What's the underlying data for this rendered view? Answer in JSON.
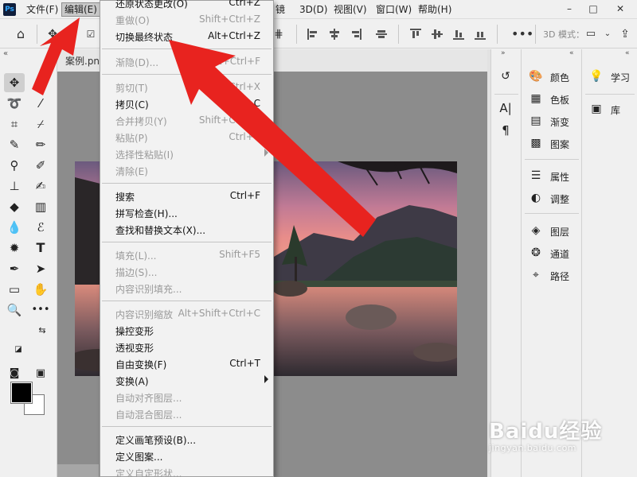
{
  "app": {
    "logo_text": "Ps"
  },
  "menubar": {
    "items": [
      "文件(F)",
      "编辑(E)",
      "镜",
      "3D(D)",
      "视图(V)",
      "窗口(W)",
      "帮助(H)"
    ],
    "active": "编辑(E)"
  },
  "window_controls": [
    "–",
    "□",
    "✕"
  ],
  "options_bar": {
    "three_d_label": "3D 模式："
  },
  "document": {
    "tab_name": "案例.png"
  },
  "edit_menu": {
    "items": [
      {
        "label": "还原状态更改(O)",
        "shortcut": "Ctrl+Z",
        "enabled": true
      },
      {
        "label": "重做(O)",
        "shortcut": "Shift+Ctrl+Z",
        "enabled": false
      },
      {
        "label": "切换最终状态",
        "shortcut": "Alt+Ctrl+Z",
        "enabled": true
      },
      {
        "separator": true
      },
      {
        "label": "渐隐(D)...",
        "shortcut": "Shift+Ctrl+F",
        "enabled": false
      },
      {
        "separator": true
      },
      {
        "label": "剪切(T)",
        "shortcut": "Ctrl+X",
        "enabled": false
      },
      {
        "label": "拷贝(C)",
        "shortcut": "Ctrl+C",
        "enabled": true
      },
      {
        "label": "合并拷贝(Y)",
        "shortcut": "Shift+Ctrl+C",
        "enabled": false
      },
      {
        "label": "粘贴(P)",
        "shortcut": "Ctrl+V",
        "enabled": false
      },
      {
        "label": "选择性粘贴(I)",
        "shortcut": "",
        "enabled": false,
        "submenu": true
      },
      {
        "label": "清除(E)",
        "shortcut": "",
        "enabled": false
      },
      {
        "separator": true
      },
      {
        "label": "搜索",
        "shortcut": "Ctrl+F",
        "enabled": true
      },
      {
        "label": "拼写检查(H)...",
        "shortcut": "",
        "enabled": true
      },
      {
        "label": "查找和替换文本(X)...",
        "shortcut": "",
        "enabled": true
      },
      {
        "separator": true
      },
      {
        "label": "填充(L)...",
        "shortcut": "Shift+F5",
        "enabled": false
      },
      {
        "label": "描边(S)...",
        "shortcut": "",
        "enabled": false
      },
      {
        "label": "内容识别填充...",
        "shortcut": "",
        "enabled": false
      },
      {
        "separator": true
      },
      {
        "label": "内容识别缩放",
        "shortcut": "Alt+Shift+Ctrl+C",
        "enabled": false
      },
      {
        "label": "操控变形",
        "shortcut": "",
        "enabled": true
      },
      {
        "label": "透视变形",
        "shortcut": "",
        "enabled": true
      },
      {
        "label": "自由变换(F)",
        "shortcut": "Ctrl+T",
        "enabled": true
      },
      {
        "label": "变换(A)",
        "shortcut": "",
        "enabled": true,
        "submenu": true
      },
      {
        "label": "自动对齐图层...",
        "shortcut": "",
        "enabled": false
      },
      {
        "label": "自动混合图层...",
        "shortcut": "",
        "enabled": false
      },
      {
        "separator": true
      },
      {
        "label": "定义画笔预设(B)...",
        "shortcut": "",
        "enabled": true
      },
      {
        "label": "定义图案...",
        "shortcut": "",
        "enabled": true
      },
      {
        "label": "定义自定形状...",
        "shortcut": "",
        "enabled": false
      }
    ]
  },
  "right_panels": {
    "column1": [
      {
        "icon": "history-icon",
        "glyph": "↺"
      },
      {
        "icon": "character-icon",
        "glyph": "A|"
      },
      {
        "icon": "paragraph-icon",
        "glyph": "¶"
      }
    ],
    "column2": [
      {
        "label": "颜色",
        "icon": "palette-icon",
        "glyph": "🎨"
      },
      {
        "label": "色板",
        "icon": "swatches-icon",
        "glyph": "▦"
      },
      {
        "label": "渐变",
        "icon": "gradient-icon",
        "glyph": "▤"
      },
      {
        "label": "图案",
        "icon": "pattern-icon",
        "glyph": "▩"
      },
      {
        "label": "属性",
        "icon": "properties-icon",
        "glyph": "☰"
      },
      {
        "label": "调整",
        "icon": "adjustments-icon",
        "glyph": "◐"
      },
      {
        "label": "图层",
        "icon": "layers-icon",
        "glyph": "◈"
      },
      {
        "label": "通道",
        "icon": "channels-icon",
        "glyph": "❂"
      },
      {
        "label": "路径",
        "icon": "paths-icon",
        "glyph": "⌖"
      }
    ],
    "column3": [
      {
        "label": "学习",
        "icon": "learn-icon",
        "glyph": "💡"
      },
      {
        "label": "库",
        "icon": "libraries-icon",
        "glyph": "▣"
      }
    ]
  },
  "watermark": {
    "main": "Baidu经验",
    "sub": "jingyan.baidu.com"
  }
}
